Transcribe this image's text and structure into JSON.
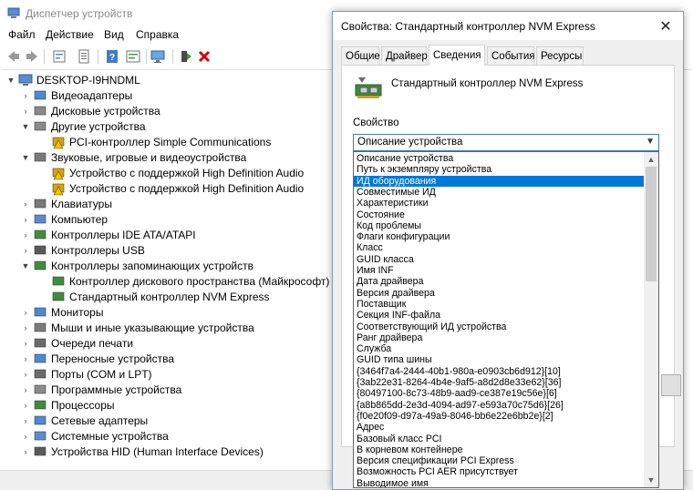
{
  "window": {
    "title": "Диспетчер устройств",
    "menu": [
      "Файл",
      "Действие",
      "Вид",
      "Справка"
    ]
  },
  "toolbar": {
    "buttons": [
      "back-icon",
      "forward-icon",
      "show-hide-icon",
      "properties-icon",
      "help-icon",
      "view-icon",
      "scan-hardware-icon",
      "update-driver-icon",
      "uninstall-icon"
    ]
  },
  "tree": {
    "root": "DESKTOP-I9HNDML",
    "items": [
      {
        "label": "Видеоадаптеры",
        "level": 1,
        "expanded": false,
        "icon": "display-adapter-icon"
      },
      {
        "label": "Дисковые устройства",
        "level": 1,
        "expanded": false,
        "icon": "disk-drive-icon"
      },
      {
        "label": "Другие устройства",
        "level": 1,
        "expanded": true,
        "icon": "other-devices-icon"
      },
      {
        "label": "PCI-контроллер Simple Communications",
        "level": 2,
        "icon": "warning-device-icon"
      },
      {
        "label": "Звуковые, игровые и видеоустройства",
        "level": 1,
        "expanded": true,
        "icon": "sound-icon"
      },
      {
        "label": "Устройство с поддержкой High Definition Audio",
        "level": 2,
        "icon": "audio-device-icon"
      },
      {
        "label": "Устройство с поддержкой High Definition Audio",
        "level": 2,
        "icon": "audio-device-icon"
      },
      {
        "label": "Клавиатуры",
        "level": 1,
        "expanded": false,
        "icon": "keyboard-icon"
      },
      {
        "label": "Компьютер",
        "level": 1,
        "expanded": false,
        "icon": "computer-icon"
      },
      {
        "label": "Контроллеры IDE ATA/ATAPI",
        "level": 1,
        "expanded": false,
        "icon": "ide-controller-icon"
      },
      {
        "label": "Контроллеры USB",
        "level": 1,
        "expanded": false,
        "icon": "usb-icon"
      },
      {
        "label": "Контроллеры запоминающих устройств",
        "level": 1,
        "expanded": true,
        "icon": "storage-controller-icon"
      },
      {
        "label": "Контроллер дискового пространства (Майкрософт)",
        "level": 2,
        "icon": "storage-device-icon"
      },
      {
        "label": "Стандартный контроллер NVM Express",
        "level": 2,
        "icon": "storage-device-icon"
      },
      {
        "label": "Мониторы",
        "level": 1,
        "expanded": false,
        "icon": "monitor-icon"
      },
      {
        "label": "Мыши и иные указывающие устройства",
        "level": 1,
        "expanded": false,
        "icon": "mouse-icon"
      },
      {
        "label": "Очереди печати",
        "level": 1,
        "expanded": false,
        "icon": "printer-icon"
      },
      {
        "label": "Переносные устройства",
        "level": 1,
        "expanded": false,
        "icon": "portable-device-icon"
      },
      {
        "label": "Порты (COM и LPT)",
        "level": 1,
        "expanded": false,
        "icon": "port-icon"
      },
      {
        "label": "Программные устройства",
        "level": 1,
        "expanded": false,
        "icon": "software-device-icon"
      },
      {
        "label": "Процессоры",
        "level": 1,
        "expanded": false,
        "icon": "processor-icon"
      },
      {
        "label": "Сетевые адаптеры",
        "level": 1,
        "expanded": false,
        "icon": "network-adapter-icon"
      },
      {
        "label": "Системные устройства",
        "level": 1,
        "expanded": false,
        "icon": "system-device-icon"
      },
      {
        "label": "Устройства HID (Human Interface Devices)",
        "level": 1,
        "expanded": false,
        "icon": "hid-icon"
      }
    ]
  },
  "dialog": {
    "title": "Свойства: Стандартный контроллер NVM Express",
    "close_label": "✕",
    "tabs": [
      "Общие",
      "Драйвер",
      "Сведения",
      "События",
      "Ресурсы"
    ],
    "active_tab": 2,
    "device_name": "Стандартный контроллер NVM Express",
    "property_label": "Свойство",
    "selected_property": "Описание устройства",
    "dropdown_options": [
      "Описание устройства",
      "Путь к экземпляру устройства",
      "ИД оборудования",
      "Совместимые ИД",
      "Характеристики",
      "Состояние",
      "Код проблемы",
      "Флаги конфигурации",
      "Класс",
      "GUID класса",
      "Имя INF",
      "Дата драйвера",
      "Версия драйвера",
      "Поставщик",
      "Секция INF-файла",
      "Соответствующий ИД устройства",
      "Ранг драйвера",
      "Служба",
      "GUID типа шины",
      "{3464f7a4-2444-40b1-980a-e0903cb6d912}[10]",
      "{3ab22e31-8264-4b4e-9af5-a8d2d8e33e62}[36]",
      "{80497100-8c73-48b9-aad9-ce387e19c56e}[6]",
      "{a8b865dd-2e3d-4094-ad97-e593a70c75d6}[26]",
      "{f0e20f09-d97a-49a9-8046-bb6e22e6bb2e}[2]",
      "Адрес",
      "Базовый класс PCI",
      "В корневом контейнере",
      "Версия спецификации PCI Express",
      "Возможность PCI AER присутствует",
      "Выводимое имя"
    ],
    "highlighted_option": 2
  },
  "colors": {
    "selection": "#0078d7",
    "dialog_border": "#7a9ed1",
    "uninstall_red": "#d40000"
  }
}
